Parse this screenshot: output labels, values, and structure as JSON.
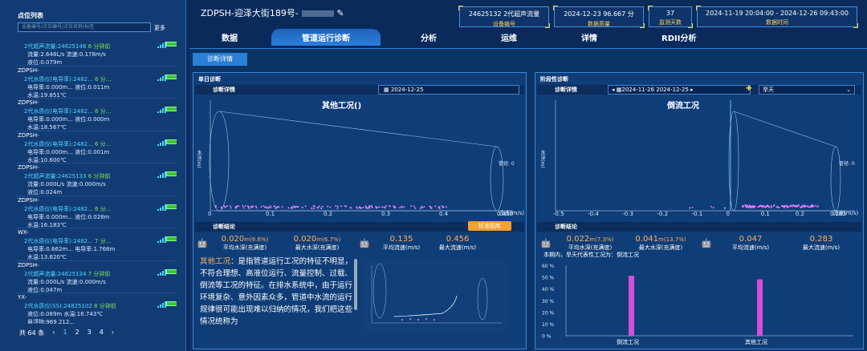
{
  "sidebar": {
    "title": "点位列表",
    "search_placeholder": "设备编号/点位编号/点位名称/标签",
    "more": "更多",
    "items": [
      {
        "name": "",
        "l1": "2代超声流量:24625146",
        "l1t": "6 分钟前",
        "l2": "流量:2.646L/s   流速:0.178m/s",
        "l3": "液位:0.079m"
      },
      {
        "name": "ZDPSH-",
        "l1": "2代水质仪(电导率):2482...",
        "l1t": "6 分...",
        "l2": "电导率:0.000m...  液位:0.011m",
        "l3": "水温:19.851℃"
      },
      {
        "name": "ZDPSH-",
        "l1": "2代水质仪(电导率):2482...",
        "l1t": "6 分...",
        "l2": "电导率:0.000m...  液位:0.000m",
        "l3": "水温:18.567℃"
      },
      {
        "name": "ZDPSH-",
        "l1": "2代水质仪(电导率):2482...",
        "l1t": "6 分...",
        "l2": "电导率:0.000m...  液位:0.001m",
        "l3": "水温:10.600℃"
      },
      {
        "name": "ZDPSH-",
        "l1": "2代超声流量:24625133",
        "l1t": "6 分钟前",
        "l2": "流量:0.000L/s   流速:0.000m/s",
        "l3": "液位:0.024m"
      },
      {
        "name": "ZDPSH-",
        "l1": "2代水质仪(电导率):2482...",
        "l1t": "6 分...",
        "l2": "电导率:0.000m...  液位:0.028m",
        "l3": "水温:16.183℃"
      },
      {
        "name": "WX-",
        "l1": "2代水质仪(电导率):2482...",
        "l1t": "7 分...",
        "l2": "电导率:0.662m...  电导率:1.768m",
        "l3": "水温:13.620℃"
      },
      {
        "name": "ZDPSH-",
        "l1": "2代超声流量:24625134",
        "l1t": "7 分钟前",
        "l2": "流量:0.000L/s   流速:0.000m/s",
        "l3": "液位:0.047m"
      },
      {
        "name": "YX-",
        "l1": "2代水质仪(SS):24825102",
        "l1t": "8 分钟前",
        "l2": "液位:0.089m   水温:16.743℃",
        "l3": "悬浮物:969.212..."
      }
    ],
    "pager": {
      "total": "共 64 条",
      "pages": [
        "1",
        "2",
        "3",
        "4"
      ]
    }
  },
  "header": {
    "title": "ZDPSH-迎泽大街189号-"
  },
  "stats": [
    {
      "v": "24625132 2代超声流量",
      "k": "设备编号"
    },
    {
      "v": "2024-12-23  96.667 分",
      "k": "数据质量"
    },
    {
      "v": "37",
      "k": "监测天数"
    },
    {
      "v": "2024-11-19 20:04:00 - 2024-12-26 09:43:00",
      "k": "数据时间"
    }
  ],
  "tabs": [
    "数据",
    "管道运行诊断",
    "分析",
    "运维",
    "详情",
    "RDII分析"
  ],
  "subtab": "诊断详情",
  "left": {
    "title": "单日诊断",
    "detail": "诊断详情",
    "date": "2024-12-25",
    "chart_title": "其他工况()",
    "conclusion": "诊断结论",
    "btn": "标准图库",
    "s1": "0.020",
    "s1p": "(6.6%)",
    "s1k": "平均水深(充满度)",
    "s2": "0.020",
    "s2p": "(6.7%)",
    "s2k": "最大水深(充满度)",
    "s3": "0.135",
    "s3k": "平均流速(m/s)",
    "s4": "0.456",
    "s4k": "最大流速(m/s)",
    "desc": "其他工况：是指管道运行工况的特征不明显，不符合理想、高液位运行、流量控制、过载、倒流等工况的特征。在排水系统中，由于运行环境复杂、意外因素众多，管道中水流的运行规律很可能出现难以归纳的情况，我们把这些情况统称为",
    "desc_hl": "其他工况",
    "pipe": "管径: 0",
    "ylabel": "水深(m)",
    "xlabel": "流速(m/s)"
  },
  "right": {
    "title": "阶段性诊断",
    "detail": "诊断详情",
    "date": "2024-11-26  2024-12-25",
    "weather": "旱天",
    "chart_title": "倒流工况",
    "conclusion": "诊断结论",
    "s1": "0.022",
    "s1p": "(7.3%)",
    "s1k": "平均水深(充满度)",
    "s2": "0.041",
    "s2p": "(13.7%)",
    "s2k": "最大水深(充满度)",
    "s3": "0.047",
    "s3k": "平均流速(m/s)",
    "s4": "0.283",
    "s4k": "最大流速(m/s)",
    "note": "本期内，旱天代表性工况为：倒流工况",
    "pipe": "管径: 0",
    "ylabel": "水深(m)",
    "xlabel": "流速(m/s)"
  },
  "chart_data": [
    {
      "type": "scatter",
      "title": "其他工况()",
      "xlabel": "流速(m/s)",
      "ylabel": "水深(m)",
      "x_ticks": [
        "0",
        "0.1",
        "0.2",
        "0.3",
        "0.4",
        "0.456"
      ],
      "xlim": [
        0,
        0.456
      ]
    },
    {
      "type": "scatter",
      "title": "倒流工况",
      "xlabel": "流速(m/s)",
      "ylabel": "水深(m)",
      "x_ticks": [
        "-0.5",
        "-0.4",
        "-0.3",
        "-0.2",
        "-0.1",
        "0",
        "0.1",
        "0.2",
        "0.283"
      ],
      "xlim": [
        -0.5,
        0.283
      ]
    },
    {
      "type": "bar",
      "categories": [
        "倒流工况",
        "其他工况"
      ],
      "values": [
        51,
        48
      ],
      "y_ticks": [
        "60 %",
        "50 %",
        "40 %",
        "30 %",
        "20 %",
        "10 %",
        "0 %"
      ],
      "ylim": [
        0,
        60
      ]
    }
  ]
}
